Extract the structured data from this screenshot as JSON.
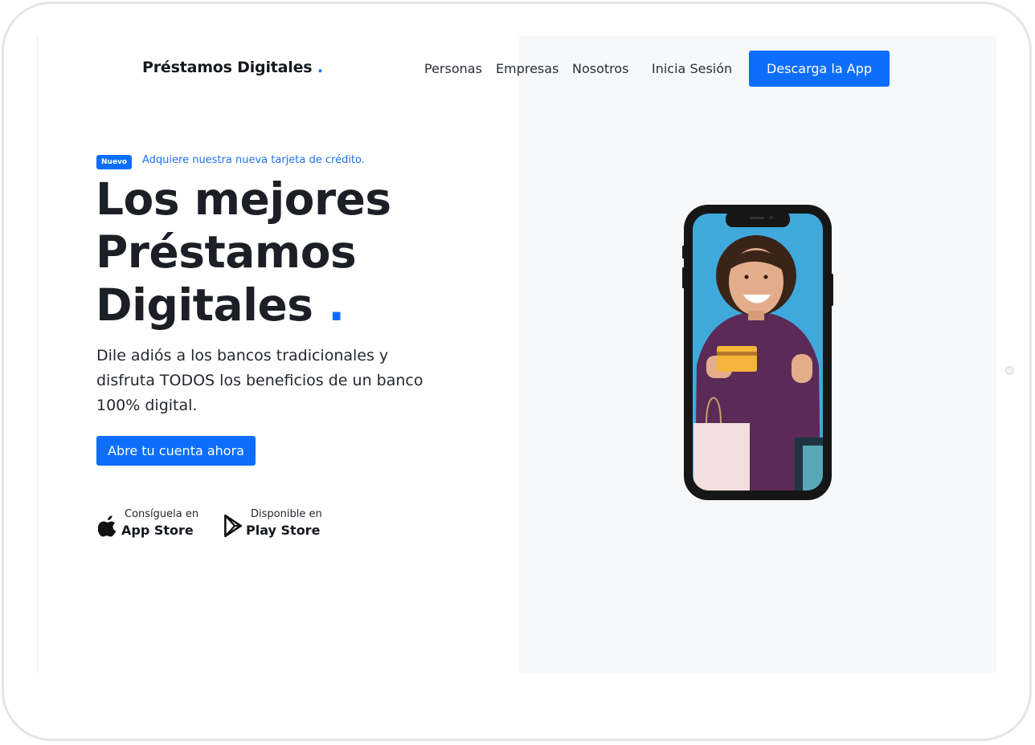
{
  "brand": {
    "name": "Préstamos Digitales",
    "dot": ".",
    "accent_color": "#0d6efd"
  },
  "nav": {
    "items": [
      "Personas",
      "Empresas",
      "Nosotros"
    ],
    "login_label": "Inicia Sesión",
    "download_label": "Descarga la App"
  },
  "hero": {
    "badge": "Nuevo",
    "announcement": "Adquiere nuestra nueva tarjeta de crédito.",
    "headline_lines": [
      "Los mejores",
      "Préstamos",
      "Digitales"
    ],
    "headline_dot": ".",
    "subtitle": "Dile adiós a los bancos tradicionales y disfruta TODOS los beneficios de un banco 100% digital.",
    "cta_label": "Abre tu cuenta ahora"
  },
  "stores": {
    "apple": {
      "small": "Consíguela en",
      "big": "App Store",
      "icon": "apple-icon"
    },
    "google": {
      "small": "Disponible en",
      "big": "Play Store",
      "icon": "play-store-icon"
    }
  },
  "phone_image": {
    "icon": "phone-mockup-woman-with-credit-card"
  }
}
